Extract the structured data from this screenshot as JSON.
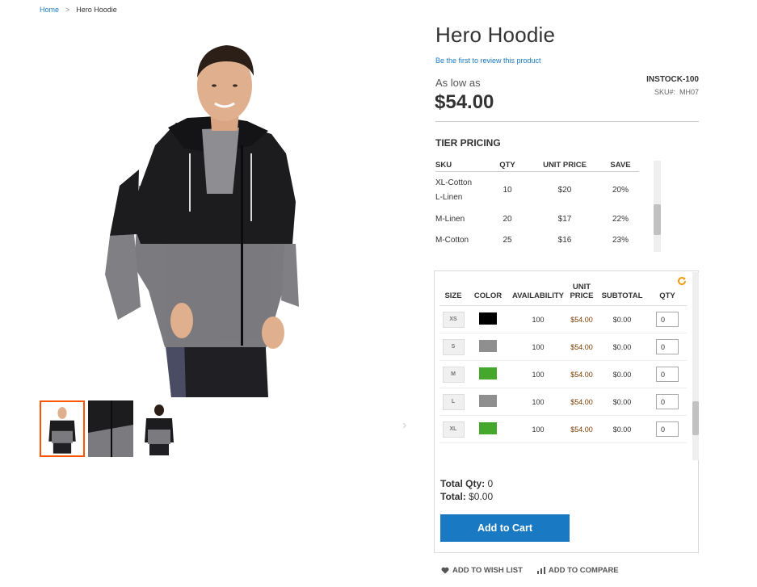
{
  "breadcrumb": {
    "home": "Home",
    "separator": ">",
    "current": "Hero Hoodie"
  },
  "product": {
    "title": "Hero Hoodie",
    "review_link": "Be the first to review this product",
    "as_low_as": "As low as",
    "price": "$54.00",
    "stock_status": "INSTOCK-100",
    "sku_label": "SKU#:",
    "sku_value": "MH07"
  },
  "tier_pricing": {
    "title": "TIER PRICING",
    "headers": {
      "sku": "SKU",
      "qty": "QTY",
      "unit_price": "UNIT PRICE",
      "save": "SAVE"
    },
    "rows": [
      {
        "sku_line1": "XL-Cotton",
        "sku_line2": "L-Linen",
        "qty": "10",
        "unit_price": "$20",
        "save": "20%"
      },
      {
        "sku_line1": "M-Linen",
        "sku_line2": "",
        "qty": "20",
        "unit_price": "$17",
        "save": "22%"
      },
      {
        "sku_line1": "M-Cotton",
        "sku_line2": "",
        "qty": "25",
        "unit_price": "$16",
        "save": "23%"
      }
    ]
  },
  "matrix": {
    "headers": {
      "size": "SIZE",
      "color": "COLOR",
      "availability": "AVAILABILITY",
      "unit_price_1": "UNIT",
      "unit_price_2": "PRICE",
      "subtotal": "SUBTOTAL",
      "qty": "QTY"
    },
    "rows": [
      {
        "size": "XS",
        "color_hex": "#000000",
        "availability": "100",
        "unit_price": "$54.00",
        "subtotal": "$0.00",
        "qty": "0"
      },
      {
        "size": "S",
        "color_hex": "#8f8f8f",
        "availability": "100",
        "unit_price": "$54.00",
        "subtotal": "$0.00",
        "qty": "0"
      },
      {
        "size": "M",
        "color_hex": "#45a72c",
        "availability": "100",
        "unit_price": "$54.00",
        "subtotal": "$0.00",
        "qty": "0"
      },
      {
        "size": "L",
        "color_hex": "#8f8f8f",
        "availability": "100",
        "unit_price": "$54.00",
        "subtotal": "$0.00",
        "qty": "0"
      },
      {
        "size": "XL",
        "color_hex": "#45a72c",
        "availability": "100",
        "unit_price": "$54.00",
        "subtotal": "$0.00",
        "qty": "0"
      }
    ],
    "total_qty_label": "Total Qty:",
    "total_qty_value": "0",
    "total_label": "Total:",
    "total_value": "$0.00",
    "add_to_cart": "Add to Cart"
  },
  "actions": {
    "wishlist": "ADD TO WISH LIST",
    "compare": "ADD TO COMPARE"
  },
  "icons": {
    "refresh": "refresh-icon",
    "heart": "heart-icon",
    "compare": "bar-chart-icon",
    "next": "chevron-right-icon"
  },
  "colors": {
    "link": "#1979c3",
    "button": "#1979c3",
    "active_thumb": "#ff5501",
    "refresh": "#f39c12"
  }
}
